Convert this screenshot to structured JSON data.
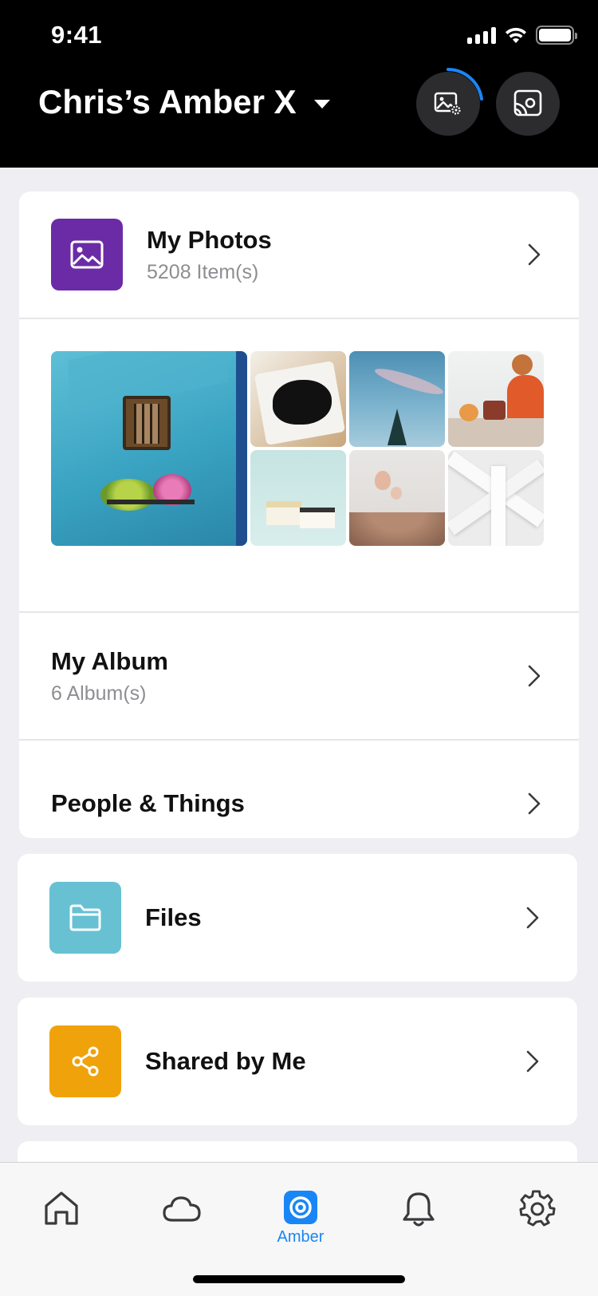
{
  "status_bar": {
    "time": "9:41"
  },
  "header": {
    "device_name": "Chris’s Amber X"
  },
  "photos_card": {
    "title": "My Photos",
    "count": "5208 Item(s)",
    "tile_color": "#6b2ba6"
  },
  "album_row": {
    "title": "My Album",
    "count": "6 Album(s)"
  },
  "people_row": {
    "title": "People & Things"
  },
  "files_row": {
    "title": "Files",
    "tile_color": "#67c1d3"
  },
  "shared_row": {
    "title": "Shared by Me",
    "tile_color": "#f0a20a"
  },
  "tabbar": {
    "tabs": [
      {
        "icon": "home-icon",
        "label": ""
      },
      {
        "icon": "cloud-icon",
        "label": ""
      },
      {
        "icon": "amber-icon",
        "label": "Amber"
      },
      {
        "icon": "bell-icon",
        "label": ""
      },
      {
        "icon": "gear-icon",
        "label": ""
      }
    ],
    "active_color": "#1a86f5"
  }
}
